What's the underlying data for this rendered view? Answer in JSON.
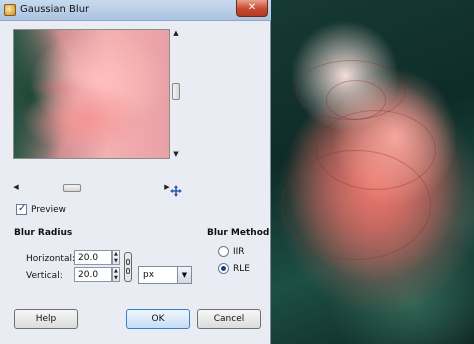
{
  "window": {
    "title": "Gaussian Blur",
    "close_glyph": "✕"
  },
  "preview": {
    "label": "Preview",
    "checked": true
  },
  "blur_radius": {
    "heading": "Blur Radius",
    "horizontal_label": "Horizontal:",
    "horizontal_value": "20.0",
    "vertical_label": "Vertical:",
    "vertical_value": "20.0",
    "unit": "px"
  },
  "blur_method": {
    "heading": "Blur Method",
    "options": [
      {
        "label": "IIR",
        "selected": false
      },
      {
        "label": "RLE",
        "selected": true
      }
    ]
  },
  "buttons": {
    "help": "Help",
    "ok": "OK",
    "cancel": "Cancel"
  },
  "icons": [
    "gimp-app-icon",
    "close-icon",
    "navigate-icon",
    "chain-icon",
    "dropdown-arrow-icon"
  ]
}
